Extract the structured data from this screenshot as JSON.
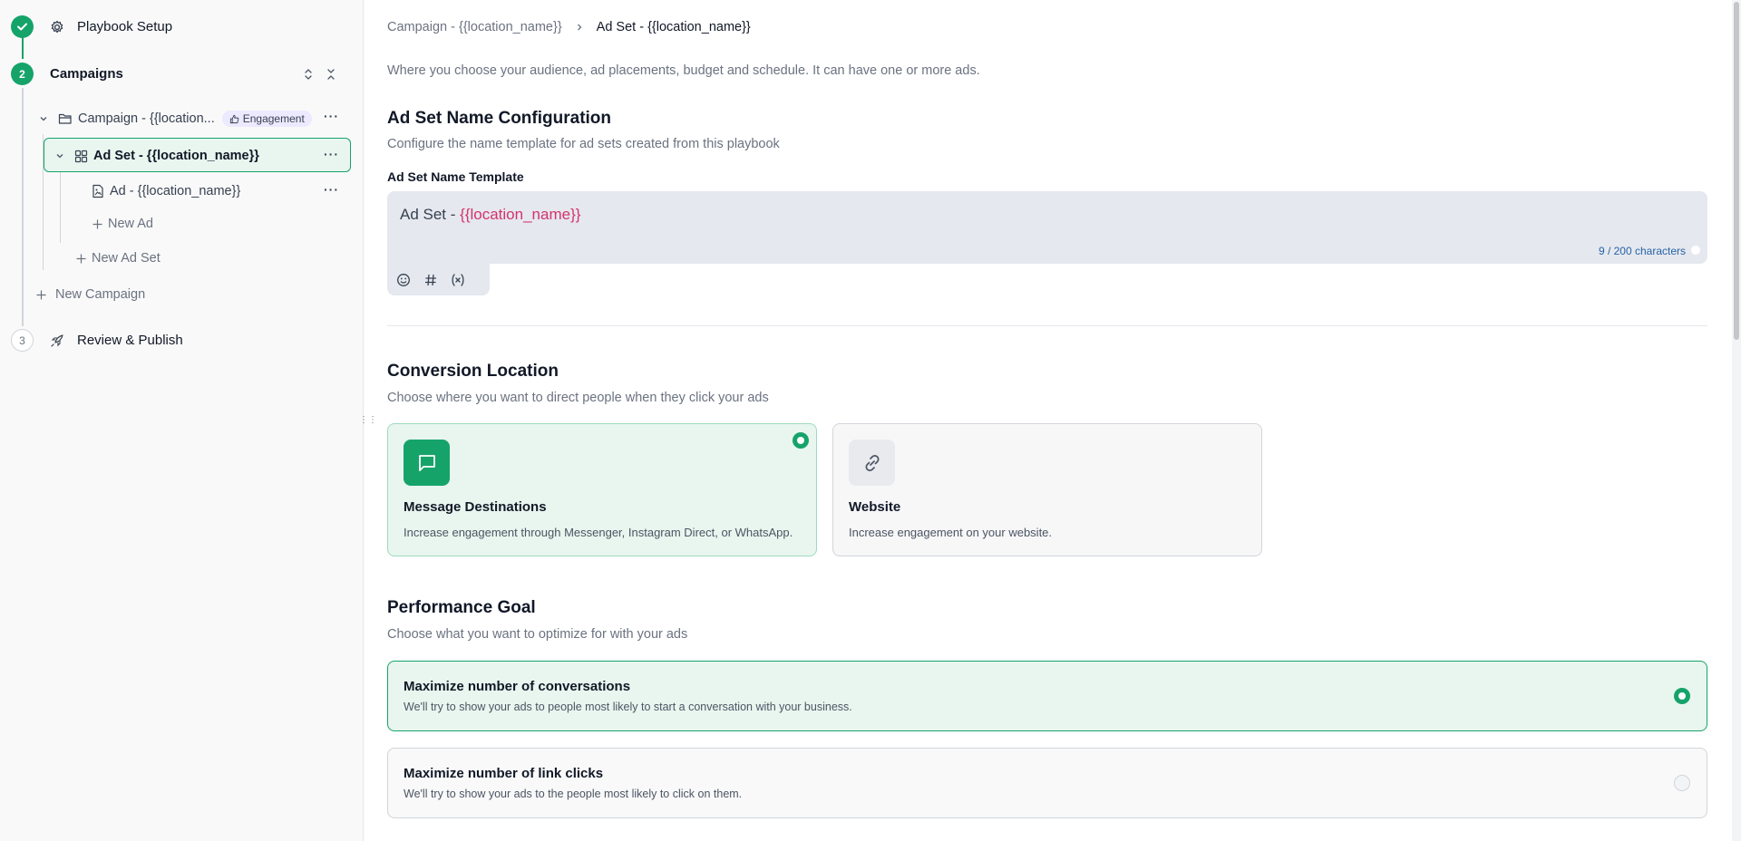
{
  "sidebar": {
    "steps": [
      {
        "number": "",
        "title": "Playbook Setup",
        "icon": "gear-icon",
        "status": "complete"
      },
      {
        "number": "2",
        "title": "Campaigns",
        "status": "active"
      },
      {
        "number": "3",
        "title": "Review & Publish",
        "icon": "rocket-icon",
        "status": "todo"
      }
    ],
    "tree": {
      "campaign": {
        "label": "Campaign - {{location...",
        "badge": "Engagement"
      },
      "ad_set": {
        "label": "Ad Set - {{location_name}}"
      },
      "ad": {
        "label": "Ad - {{location_name}}"
      },
      "new_ad": "New Ad",
      "new_ad_set": "New Ad Set",
      "new_campaign": "New Campaign"
    }
  },
  "breadcrumb": {
    "parent": "Campaign - {{location_name}}",
    "current": "Ad Set - {{location_name}}"
  },
  "intro": "Where you choose your audience, ad placements, budget and schedule. It can have one or more ads.",
  "name_config": {
    "title": "Ad Set Name Configuration",
    "subtitle": "Configure the name template for ad sets created from this playbook",
    "field_label": "Ad Set Name Template",
    "value_prefix": "Ad Set - ",
    "value_variable": "{{location_name}}",
    "char_count": "9 / 200 characters"
  },
  "conversion": {
    "title": "Conversion Location",
    "subtitle": "Choose where you want to direct people when they click your ads",
    "options": [
      {
        "title": "Message Destinations",
        "desc": "Increase engagement through Messenger, Instagram Direct, or WhatsApp.",
        "icon": "message-icon",
        "selected": true
      },
      {
        "title": "Website",
        "desc": "Increase engagement on your website.",
        "icon": "link-icon",
        "selected": false
      }
    ]
  },
  "performance": {
    "title": "Performance Goal",
    "subtitle": "Choose what you want to optimize for with your ads",
    "options": [
      {
        "title": "Maximize number of conversations",
        "desc": "We'll try to show your ads to people most likely to start a conversation with your business.",
        "selected": true
      },
      {
        "title": "Maximize number of link clicks",
        "desc": "We'll try to show your ads to the people most likely to click on them.",
        "selected": false
      }
    ]
  },
  "colors": {
    "accent": "#16a36a",
    "variable": "#d4336e",
    "selected_bg": "#e8f6ef"
  }
}
